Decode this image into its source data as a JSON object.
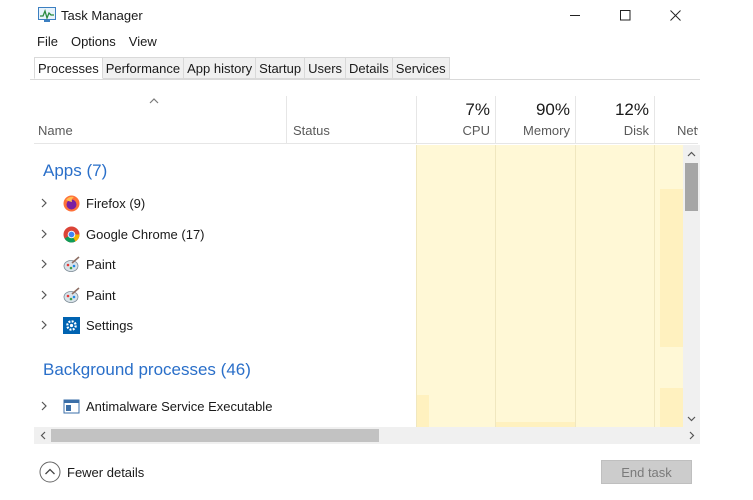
{
  "window": {
    "title": "Task Manager",
    "icon": "task-manager-icon"
  },
  "menu": [
    "File",
    "Options",
    "View"
  ],
  "tabs": [
    "Processes",
    "Performance",
    "App history",
    "Startup",
    "Users",
    "Details",
    "Services"
  ],
  "active_tab": "Processes",
  "columns": {
    "name": "Name",
    "status": "Status",
    "cpu": {
      "label": "CPU",
      "percent": "7%"
    },
    "memory": {
      "label": "Memory",
      "percent": "90%"
    },
    "disk": {
      "label": "Disk",
      "percent": "12%"
    },
    "network": {
      "label": "Network"
    }
  },
  "groups": {
    "apps": {
      "title": "Apps (7)",
      "items": [
        {
          "name": "Firefox (9)",
          "icon": "firefox-icon"
        },
        {
          "name": "Google Chrome (17)",
          "icon": "chrome-icon"
        },
        {
          "name": "Paint",
          "icon": "paint-icon"
        },
        {
          "name": "Paint",
          "icon": "paint-icon"
        },
        {
          "name": "Settings",
          "icon": "settings-gear-icon"
        }
      ]
    },
    "background": {
      "title": "Background processes (46)",
      "items": [
        {
          "name": "Antimalware Service Executable",
          "icon": "service-window-icon"
        }
      ]
    }
  },
  "footer": {
    "fewer_details": "Fewer details",
    "end_task": "End task"
  },
  "colors": {
    "group_title": "#2a6fc9",
    "heat_light": "#fff8d6",
    "heat_strong": "#fff1bf"
  }
}
